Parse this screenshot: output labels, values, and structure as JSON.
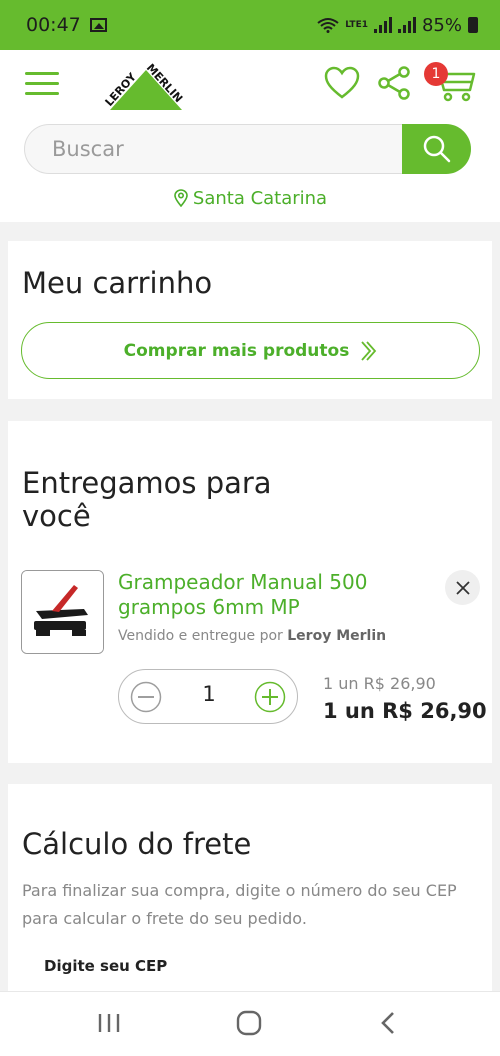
{
  "status_bar": {
    "time": "00:47",
    "battery": "85%",
    "network_label": "LTE1"
  },
  "header": {
    "logo_text": "LEROY MERLIN",
    "cart_count": "1"
  },
  "search": {
    "placeholder": "Buscar"
  },
  "location": {
    "label": "Santa Catarina"
  },
  "cart": {
    "title": "Meu carrinho",
    "more_button_label": "Comprar mais produtos"
  },
  "delivery": {
    "title_line1": "Entregamos para",
    "title_line2": "você",
    "item": {
      "name": "Grampeador Manual 500 grampos 6mm MP",
      "seller_prefix": "Vendido e entregue por",
      "seller_name": "Leroy Merlin",
      "quantity": "1",
      "unit_price": "1 un R$ 26,90",
      "total_price": "1 un R$ 26,90"
    }
  },
  "shipping": {
    "title": "Cálculo do frete",
    "description": "Para finalizar sua compra, digite o número do seu CEP para calcular o frete do seu pedido.",
    "cep_label": "Digite seu CEP"
  },
  "colors": {
    "brand_green": "#66bb2e",
    "badge_red": "#e53935"
  }
}
